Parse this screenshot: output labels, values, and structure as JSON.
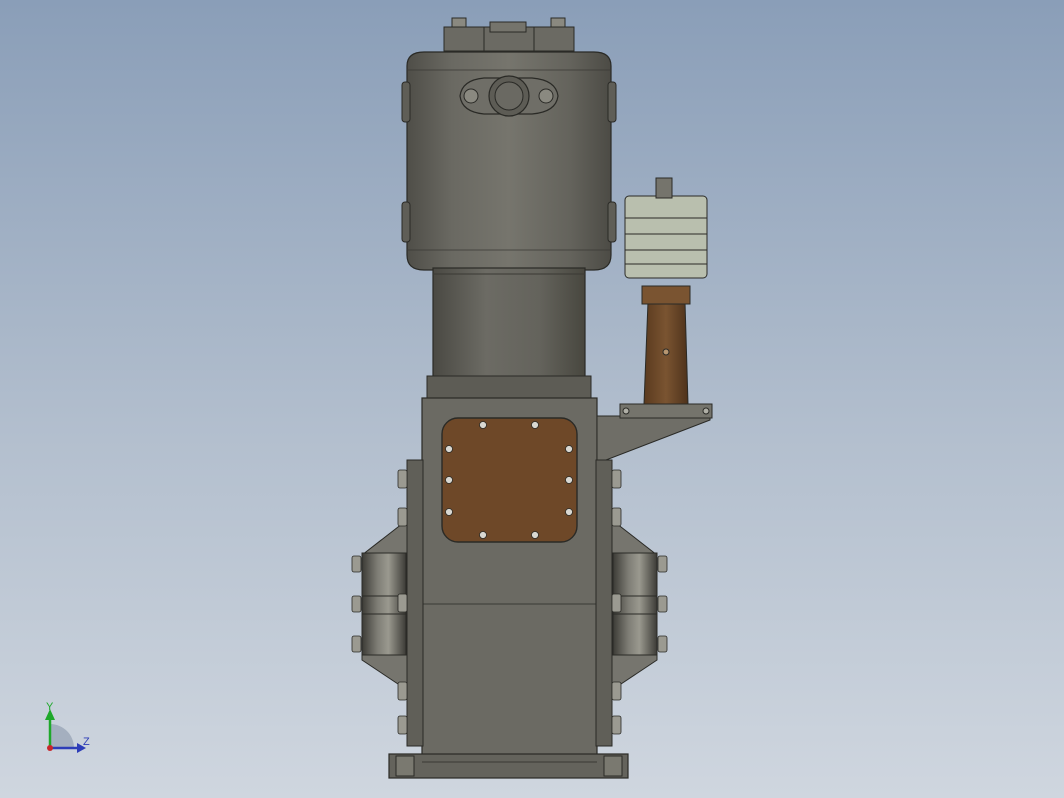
{
  "viewport": {
    "background_top": "#8a9eb8",
    "background_bottom": "#cfd6df"
  },
  "model": {
    "body_color": "#6b6a63",
    "body_dark": "#55544e",
    "body_light": "#84837b",
    "cover_color": "#6e4828",
    "column_color": "#6e4828",
    "weights_color": "#b9bfae"
  },
  "triad": {
    "y_label": "Y",
    "z_label": "Z",
    "y_color": "#1ea82a",
    "z_color": "#2d3db8",
    "x_color": "#c8262b"
  }
}
